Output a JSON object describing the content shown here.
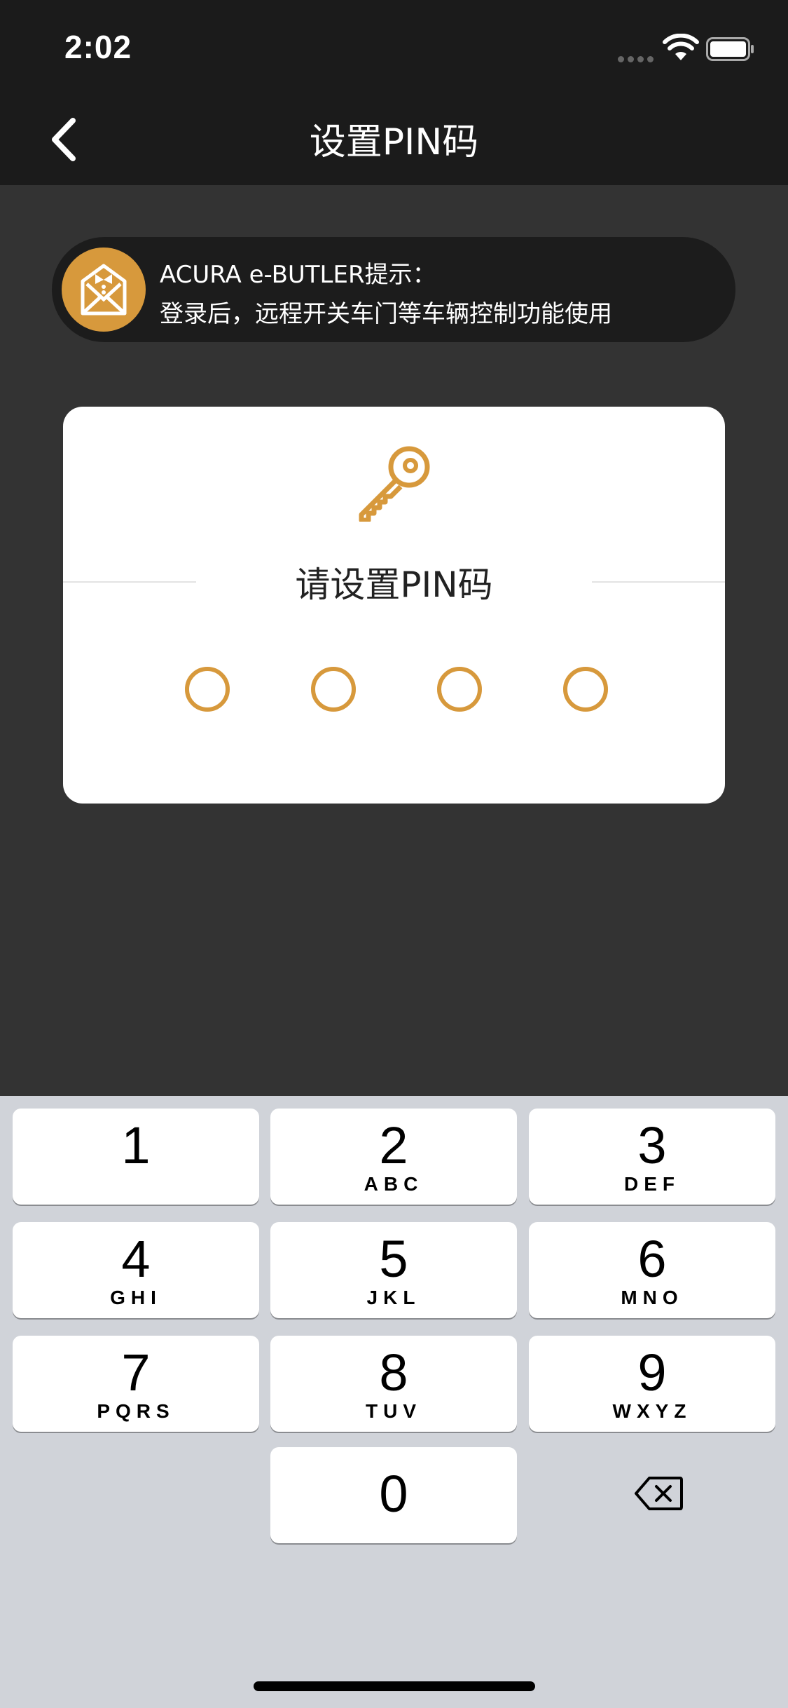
{
  "status": {
    "time": "2:02"
  },
  "nav": {
    "title": "设置PIN码"
  },
  "banner": {
    "title": "ACURA e-BUTLER提示：",
    "message": "登录后，远程开关车门等车辆控制功能使用"
  },
  "pin": {
    "prompt": "请设置PIN码",
    "length": 4,
    "entered": 0
  },
  "keypad": {
    "keys": [
      {
        "digit": "1",
        "letters": ""
      },
      {
        "digit": "2",
        "letters": "ABC"
      },
      {
        "digit": "3",
        "letters": "DEF"
      },
      {
        "digit": "4",
        "letters": "GHI"
      },
      {
        "digit": "5",
        "letters": "JKL"
      },
      {
        "digit": "6",
        "letters": "MNO"
      },
      {
        "digit": "7",
        "letters": "PQRS"
      },
      {
        "digit": "8",
        "letters": "TUV"
      },
      {
        "digit": "9",
        "letters": "WXYZ"
      },
      {
        "digit": "0",
        "letters": ""
      }
    ]
  },
  "colors": {
    "accent": "#d7993c",
    "nav_bg": "#1b1b1b",
    "page_bg": "#333333",
    "keypad_bg": "#d0d3d9"
  },
  "icons": [
    "back-chevron-icon",
    "wifi-icon",
    "battery-icon",
    "butler-mail-icon",
    "key-icon",
    "backspace-icon"
  ]
}
